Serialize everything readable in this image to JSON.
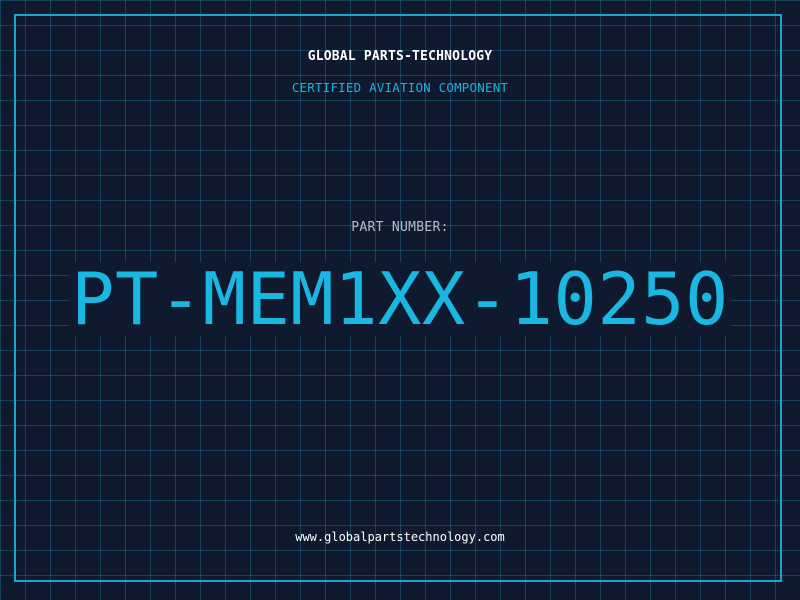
{
  "header": {
    "company": "GLOBAL PARTS-TECHNOLOGY",
    "subtitle": "CERTIFIED AVIATION COMPONENT"
  },
  "part": {
    "label": "PART NUMBER:",
    "number": "PT-MEM1XX-10250"
  },
  "footer": {
    "website": "www.globalpartstechnology.com"
  },
  "colors": {
    "background": "#0f1a2e",
    "grid": "#2296b9",
    "accent": "#1ab7e3",
    "frame": "#18a5d0",
    "label": "#b7bcc6",
    "text": "#ffffff"
  }
}
